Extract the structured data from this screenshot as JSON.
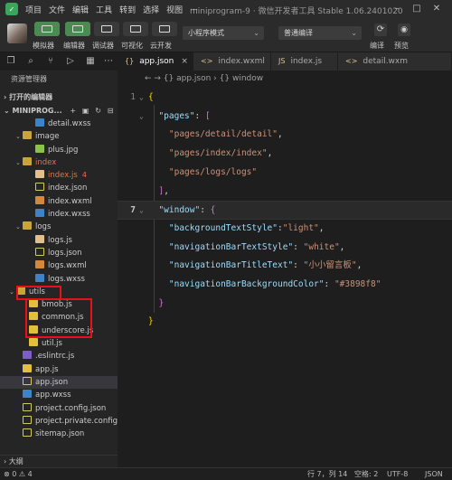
{
  "menu": [
    "项目",
    "文件",
    "编辑",
    "工具",
    "转到",
    "选择",
    "视图",
    "…"
  ],
  "window_title": "miniprogram-9 · 微信开发者工具 Stable 1.06.2401020",
  "toolbar": {
    "simulator_label": "模拟器",
    "editor_label": "编辑器",
    "debugger_label": "调试器",
    "visualize_label": "可视化",
    "cloud_label": "云开发",
    "mode_value": "小程序模式",
    "compile_value": "普通编译",
    "compile_label": "编译",
    "preview_label": "预览"
  },
  "explorer": {
    "title": "资源管理器",
    "open_editors": "打开的编辑器",
    "project": "MINIPROG...",
    "rows": [
      {
        "label": "detail.wxss",
        "type": "wxss",
        "indent": 3
      },
      {
        "label": "image",
        "type": "folder",
        "indent": 1,
        "open": true
      },
      {
        "label": "plus.jpg",
        "type": "img",
        "indent": 3
      },
      {
        "label": "index",
        "type": "folder",
        "indent": 1,
        "open": true,
        "red": true
      },
      {
        "label": "index.js",
        "type": "js",
        "indent": 3,
        "red": true,
        "badge": "4"
      },
      {
        "label": "index.json",
        "type": "json",
        "indent": 3
      },
      {
        "label": "index.wxml",
        "type": "wxml",
        "indent": 3
      },
      {
        "label": "index.wxss",
        "type": "wxss",
        "indent": 3
      },
      {
        "label": "logs",
        "type": "folder",
        "indent": 1,
        "open": true
      },
      {
        "label": "logs.js",
        "type": "js",
        "indent": 3
      },
      {
        "label": "logs.json",
        "type": "json",
        "indent": 3
      },
      {
        "label": "logs.wxml",
        "type": "wxml",
        "indent": 3
      },
      {
        "label": "logs.wxss",
        "type": "wxss",
        "indent": 3
      },
      {
        "label": "utils",
        "type": "folder",
        "indent": 0,
        "open": true
      },
      {
        "label": "bmob.js",
        "type": "jsy",
        "indent": 2
      },
      {
        "label": "common.js",
        "type": "jsy",
        "indent": 2
      },
      {
        "label": "underscore.js",
        "type": "jsy",
        "indent": 2
      },
      {
        "label": "util.js",
        "type": "jsy",
        "indent": 2
      },
      {
        "label": ".eslintrc.js",
        "type": "eslint",
        "indent": 1
      },
      {
        "label": "app.js",
        "type": "jsy",
        "indent": 1
      },
      {
        "label": "app.json",
        "type": "json",
        "indent": 1,
        "selected": true
      },
      {
        "label": "app.wxss",
        "type": "wxss",
        "indent": 1
      },
      {
        "label": "project.config.json",
        "type": "json",
        "indent": 1
      },
      {
        "label": "project.private.config.js...",
        "type": "json",
        "indent": 1
      },
      {
        "label": "sitemap.json",
        "type": "json",
        "indent": 1
      }
    ],
    "outline": "大纲"
  },
  "tabs": [
    {
      "label": "app.json",
      "icon": "{}",
      "active": true
    },
    {
      "label": "index.wxml",
      "icon": "<>"
    },
    {
      "label": "index.js",
      "icon": "JS"
    },
    {
      "label": "detail.wxm",
      "icon": "<>"
    }
  ],
  "breadcrumb": "← → {} app.json › {} window",
  "code": [
    {
      "n": "1",
      "parts": [
        [
          "br",
          "{"
        ]
      ]
    },
    {
      "n": "",
      "parts": [
        [
          "p",
          "  "
        ],
        [
          "k",
          "\"pages\""
        ],
        [
          "p",
          ": "
        ],
        [
          "br2",
          "["
        ]
      ]
    },
    {
      "n": "",
      "parts": [
        [
          "p",
          "    "
        ],
        [
          "s",
          "\"pages/detail/detail\""
        ],
        [
          "p",
          ","
        ]
      ]
    },
    {
      "n": "",
      "parts": [
        [
          "p",
          "    "
        ],
        [
          "s",
          "\"pages/index/index\""
        ],
        [
          "p",
          ","
        ]
      ]
    },
    {
      "n": "",
      "parts": [
        [
          "p",
          "    "
        ],
        [
          "s",
          "\"pages/logs/logs\""
        ]
      ]
    },
    {
      "n": "",
      "parts": [
        [
          "p",
          "  "
        ],
        [
          "br2",
          "]"
        ],
        [
          "p",
          ","
        ]
      ]
    },
    {
      "n": "7",
      "parts": [
        [
          "p",
          "  "
        ],
        [
          "k",
          "\"window\""
        ],
        [
          "p",
          ": "
        ],
        [
          "br2",
          "{"
        ]
      ],
      "current": true
    },
    {
      "n": "",
      "parts": [
        [
          "p",
          "    "
        ],
        [
          "k",
          "\"backgroundTextStyle\""
        ],
        [
          "p",
          ":"
        ],
        [
          "s",
          "\"light\""
        ],
        [
          "p",
          ","
        ]
      ]
    },
    {
      "n": "",
      "parts": [
        [
          "p",
          "    "
        ],
        [
          "k",
          "\"navigationBarTextStyle\""
        ],
        [
          "p",
          ": "
        ],
        [
          "s",
          "\"white\""
        ],
        [
          "p",
          ","
        ]
      ]
    },
    {
      "n": "",
      "parts": [
        [
          "p",
          "    "
        ],
        [
          "k",
          "\"navigationBarTitleText\""
        ],
        [
          "p",
          ": "
        ],
        [
          "s",
          "\"小小留言板\""
        ],
        [
          "p",
          ","
        ]
      ]
    },
    {
      "n": "",
      "parts": [
        [
          "p",
          "    "
        ],
        [
          "k",
          "\"navigationBarBackgroundColor\""
        ],
        [
          "p",
          ": "
        ],
        [
          "s",
          "\"#3898f8\""
        ]
      ]
    },
    {
      "n": "",
      "parts": [
        [
          "p",
          "  "
        ],
        [
          "br2",
          "}"
        ]
      ]
    },
    {
      "n": "",
      "parts": [
        [
          "br",
          "}"
        ]
      ]
    },
    {
      "n": "",
      "parts": []
    }
  ],
  "status": {
    "problems": "⊗ 0 ⚠ 4",
    "position": "行 7，列 14",
    "spaces": "空格: 2",
    "encoding": "UTF-8",
    "lang": "JSON"
  },
  "colors": {
    "accent_green": "#4c8a54",
    "highlight_red": "#e8111b",
    "string": "#ce9178",
    "key": "#9cdcfe"
  }
}
